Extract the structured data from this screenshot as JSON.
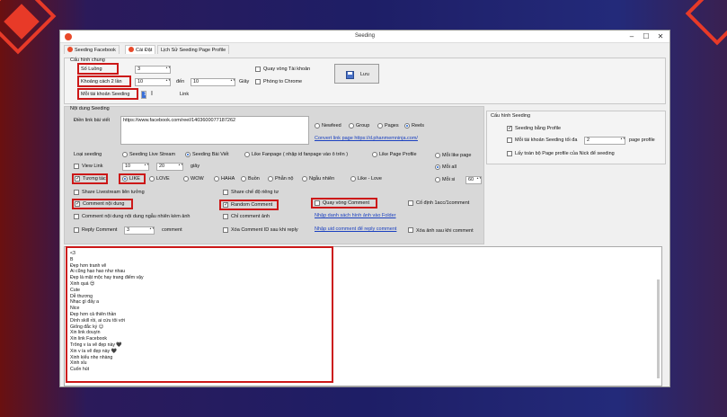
{
  "window": {
    "title": "Seeding",
    "tabs": [
      {
        "label": "Seeding Facebook"
      },
      {
        "label": "Cài Đặt"
      },
      {
        "label": "Lịch Sử Seeding Page Profile"
      }
    ]
  },
  "general": {
    "group_title": "Cấu hình chung",
    "so_luong_label": "Số Luồng",
    "so_luong_value": "3",
    "khoang_cach_label": "Khoảng cách 2 lần",
    "khoang_from": "10",
    "den_label": "đến",
    "khoang_to": "10",
    "giay_label": "Giây",
    "moi_tk_label": "Mỗi tài khoản Seeding",
    "moi_tk_value": "1",
    "link_label": "Link",
    "quay_vong_label": "Quay vòng Tài khoản",
    "phong_chrome_label": "Phòng to Chrome",
    "save_label": "Lưu"
  },
  "seeding": {
    "group_title": "Nội dung Seeding",
    "post_link_label": "Điền link bài viết",
    "post_link_value": "https://www.facebook.com/reel/1403600077187262",
    "target_options": [
      "Newfeed",
      "Group",
      "Pages",
      "Reels"
    ],
    "convert_link": "Convert link page https://d.phanmemninja.com/",
    "loai_label": "Loại seeding",
    "loai_options": [
      "Seeding Live Stream",
      "Seeding Bài Viết",
      "Like Fanpage ( nhập id fanpage vào ô trên )",
      "Like Page Profile"
    ],
    "moi_like_page": "Mỗi like page",
    "view_link_label": "View Link",
    "view_from": "10",
    "view_to": "20",
    "view_unit": "giây",
    "tuong_tac_label": "Tương tác",
    "reactions": [
      "LIKE",
      "LOVE",
      "WOW",
      "HAHA",
      "Buồn",
      "Phẫn nộ",
      "Ngẫu nhiên",
      "Like - Love"
    ],
    "moi_all": "Mỗi all",
    "moi_si": "Mỗi si",
    "moi_si_value": "60",
    "share_live": "Share Livestream liên tưởng",
    "share_rieng": "Share chế độ riêng tư",
    "comment_noi_dung": "Comment nội dung",
    "random_comment": "Random Comment",
    "quay_vong_comment": "Quay vòng Comment",
    "co_dinh": "Cố định 1acc/1comment",
    "comment_ngau_nhien": "Comment nội dung nội dung ngẫu nhiên kèm ảnh",
    "chi_comment_anh": "Chỉ comment ảnh",
    "nhap_danh_sach": "Nhập danh sách hình ảnh vào Folder",
    "reply_label": "Reply Comment",
    "reply_value": "3",
    "reply_unit": "comment",
    "xoa_comment_id": "Xóa Comment ID sau khi reply",
    "nhap_uid": "Nhập uid comment để reply comment",
    "xoa_anh": "Xóa ảnh sau khi comment"
  },
  "seeding_config": {
    "group_title": "Cấu hình Seeding",
    "seeding_profile": "Seeding bằng Profile",
    "moi_tk_seeding": "Mỗi tài khoản Seeding tối đa",
    "moi_tk_value": "2",
    "page_profile": "page profile",
    "lay_toan_bo": "Lấy toàn bộ Page profile của Nick để seeding"
  },
  "comments": [
    "<3",
    "B",
    "Đẹp hơn tranh vẽ",
    "Ai cũng hạo hao như nhau",
    "Đẹp là mặt mộc hay trang điểm vậy",
    "Xinh quá 😍",
    "Cute",
    "Dễ thương",
    "Nhạc gì đấy a",
    "Nice",
    "Đẹp hơn cả thiên thần",
    "Dính skill rồi, ai cứu tôi với",
    "Giống đắc kỷ 😉",
    "Xin link douyin",
    "Xin link Facebook",
    "Trông v ía vẽ đẹp này 🖤",
    "Xin v ía vẽ đẹp này 🖤",
    "Xinh kiểu nhẹ nhàng",
    "Xinh xỉu",
    "Cuốn hút"
  ]
}
